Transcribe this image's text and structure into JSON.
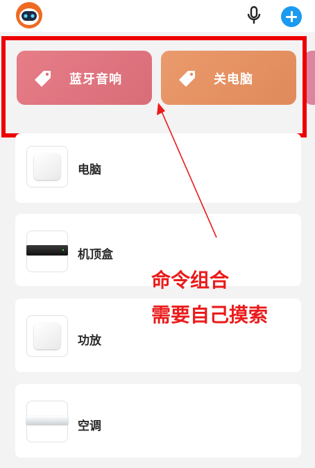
{
  "header": {
    "avatar_icon": "robot-icon",
    "mic_icon": "microphone-icon",
    "add_icon": "plus-circle-icon",
    "accent": "#1a9bf0"
  },
  "scenes": [
    {
      "label": "蓝牙音响",
      "icon": "tag-icon",
      "color": "#e07882"
    },
    {
      "label": "关电脑",
      "icon": "tag-icon",
      "color": "#e59263"
    },
    {
      "label": "",
      "icon": "",
      "color": "#dc85a0"
    }
  ],
  "devices": [
    {
      "name": "电脑",
      "icon": "white-box-icon"
    },
    {
      "name": "机顶盒",
      "icon": "set-top-box-icon"
    },
    {
      "name": "功放",
      "icon": "white-box-icon"
    },
    {
      "name": "空调",
      "icon": "air-conditioner-icon"
    }
  ],
  "annotation": {
    "line1": "命令组合",
    "line2": "需要自己摸索",
    "color": "#ea1b1b"
  }
}
